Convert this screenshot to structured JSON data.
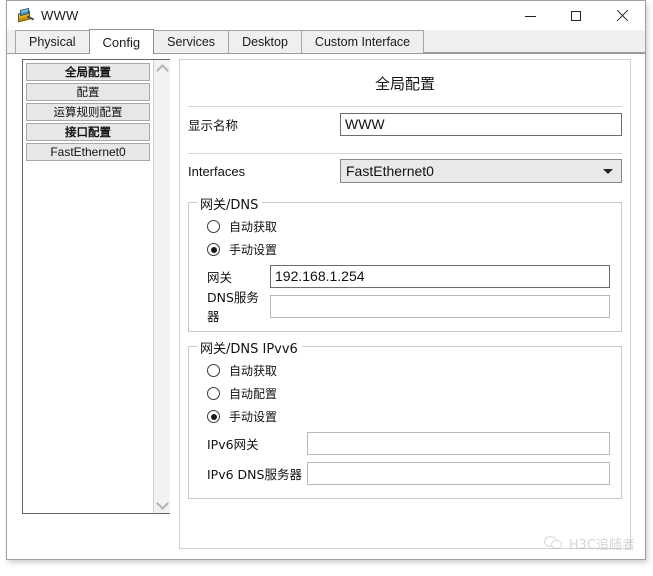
{
  "window": {
    "title": "WWW",
    "icon": "server-device-icon",
    "controls": {
      "minimize": "minimize-icon",
      "maximize": "maximize-icon",
      "close": "close-icon"
    }
  },
  "tabs": [
    {
      "label": "Physical",
      "active": false
    },
    {
      "label": "Config",
      "active": true
    },
    {
      "label": "Services",
      "active": false
    },
    {
      "label": "Desktop",
      "active": false
    },
    {
      "label": "Custom Interface",
      "active": false
    }
  ],
  "sidebar": {
    "items": [
      {
        "label": "全局配置",
        "bold": true,
        "ascii": false
      },
      {
        "label": "配置",
        "bold": false,
        "ascii": false
      },
      {
        "label": "运算规则配置",
        "bold": false,
        "ascii": false
      },
      {
        "label": "接口配置",
        "bold": true,
        "ascii": false
      },
      {
        "label": "FastEthernet0",
        "bold": false,
        "ascii": true
      }
    ],
    "scroll_up_icon": "chevron-up-icon",
    "scroll_down_icon": "chevron-down-icon"
  },
  "panel": {
    "title": "全局配置",
    "display_name": {
      "label": "显示名称",
      "value": "WWW",
      "placeholder": ""
    },
    "interfaces": {
      "label": "Interfaces",
      "value": "FastEthernet0",
      "arrow_icon": "chevron-down-icon"
    },
    "gateway_dns": {
      "title": "网关/DNS",
      "radios": [
        {
          "label": "自动获取",
          "checked": false
        },
        {
          "label": "手动设置",
          "checked": true
        }
      ],
      "gateway": {
        "label": "网关",
        "value": "192.168.1.254",
        "placeholder": ""
      },
      "dns_server": {
        "label": "DNS服务器",
        "value": "",
        "placeholder": ""
      }
    },
    "gateway_dns_ipv6": {
      "title": "网关/DNS IPvv6",
      "radios": [
        {
          "label": "自动获取",
          "checked": false
        },
        {
          "label": "自动配置",
          "checked": false
        },
        {
          "label": "手动设置",
          "checked": true
        }
      ],
      "gateway": {
        "label": "IPv6网关",
        "value": "",
        "placeholder": ""
      },
      "dns_server": {
        "label": "IPv6 DNS服务器",
        "value": "",
        "placeholder": ""
      }
    }
  },
  "watermark": {
    "icon": "wechat-icon",
    "text": "H3C追随者"
  },
  "colors": {
    "window_border": "#a0a0a0",
    "tab_active_bg": "#ffffff",
    "tab_inactive_bg": "#efefef",
    "sidebar_button_bg": "#e7e7e7",
    "combo_bg": "#e9e9e9",
    "text": "#111111"
  }
}
